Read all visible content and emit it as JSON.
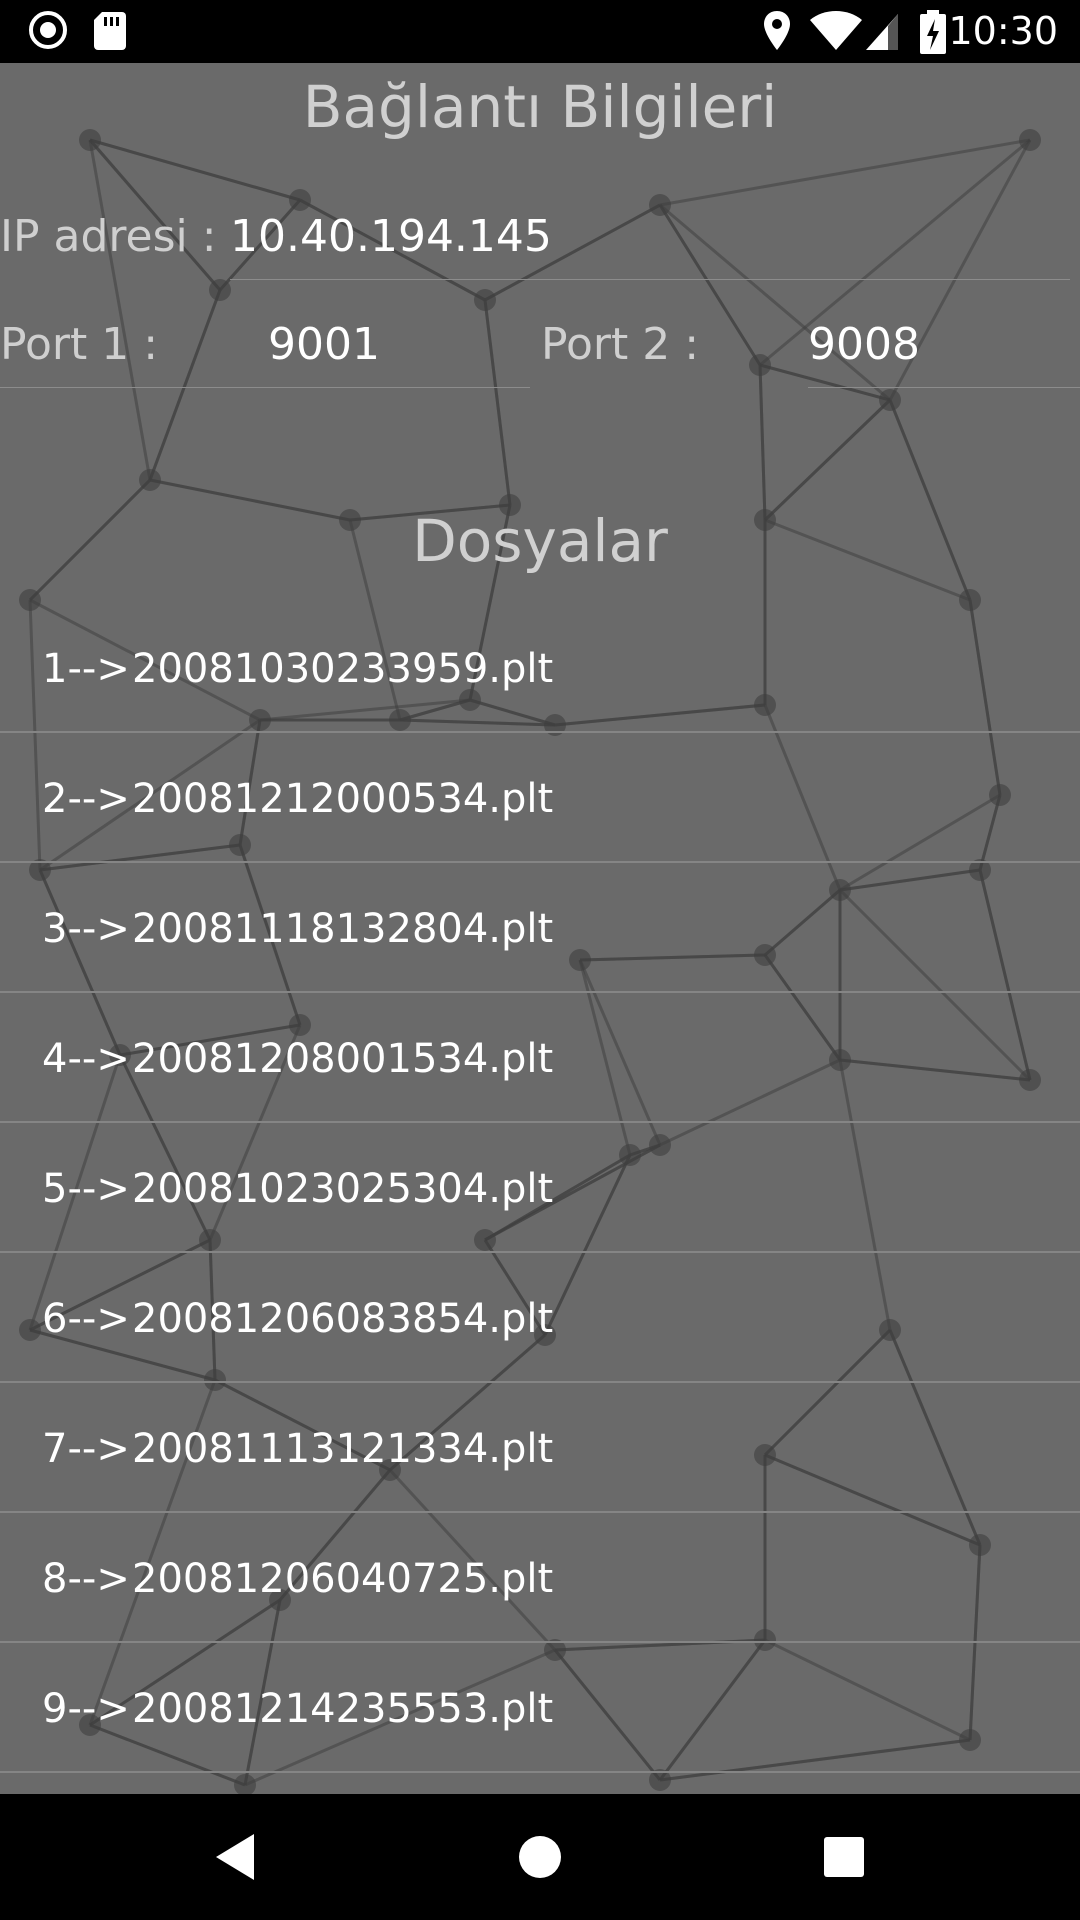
{
  "status_bar": {
    "time": "10:30",
    "icons": [
      "recording-icon",
      "sd-card-icon",
      "location-icon",
      "wifi-icon",
      "signal-icon",
      "battery-charging-icon"
    ]
  },
  "connection": {
    "title": "Bağlantı Bilgileri",
    "ip_label": "IP adresi :",
    "ip_value": "10.40.194.145",
    "port1_label": "Port 1 :",
    "port1_value": "9001",
    "port2_label": "Port 2 :",
    "port2_value": "9008"
  },
  "files": {
    "title": "Dosyalar",
    "items": [
      {
        "index": "1-->",
        "name": "20081030233959.plt"
      },
      {
        "index": "2-->",
        "name": "20081212000534.plt"
      },
      {
        "index": "3-->",
        "name": "20081118132804.plt"
      },
      {
        "index": "4-->",
        "name": "20081208001534.plt"
      },
      {
        "index": "5-->",
        "name": "20081023025304.plt"
      },
      {
        "index": "6-->",
        "name": "20081206083854.plt"
      },
      {
        "index": "7-->",
        "name": "20081113121334.plt"
      },
      {
        "index": "8-->",
        "name": "20081206040725.plt"
      },
      {
        "index": "9-->",
        "name": "20081214235553.plt"
      }
    ]
  },
  "nav_bar": {
    "icons": [
      "back-icon",
      "home-icon",
      "recents-icon"
    ]
  },
  "colors": {
    "background": "#6a6a6a",
    "bars": "#000000",
    "text": "#ffffff",
    "label_text": "#cfcfcf"
  }
}
